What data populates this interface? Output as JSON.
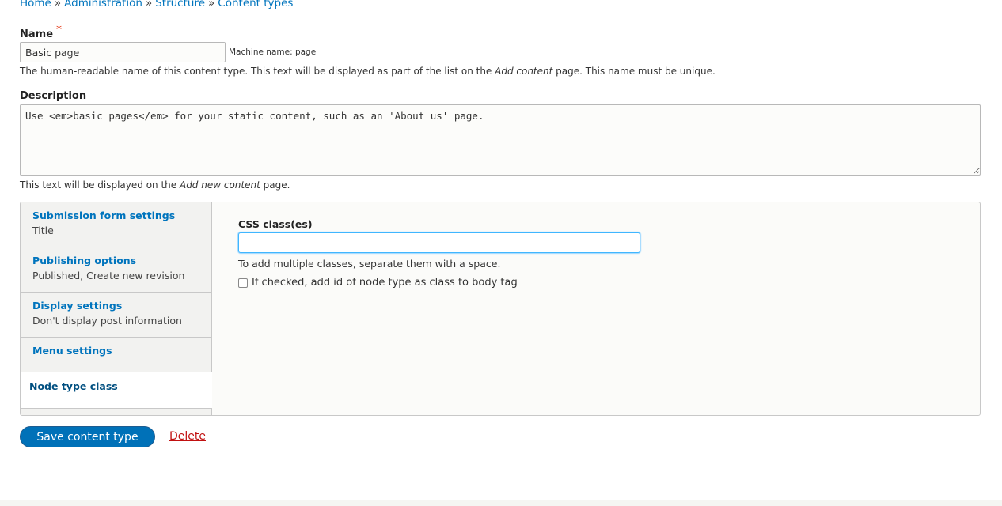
{
  "breadcrumb": {
    "items": [
      "Home",
      "Administration",
      "Structure",
      "Content types"
    ],
    "separator": "»"
  },
  "name_field": {
    "label": "Name",
    "required_marker": "*",
    "value": "Basic page",
    "machine_name": "Machine name: page",
    "help_pre": "The human-readable name of this content type. This text will be displayed as part of the list on the ",
    "help_em": "Add content",
    "help_post": " page. This name must be unique."
  },
  "description_field": {
    "label": "Description",
    "value": "Use <em>basic pages</em> for your static content, such as an 'About us' page.",
    "help_pre": "This text will be displayed on the ",
    "help_em": "Add new content",
    "help_post": " page."
  },
  "vertical_tabs": [
    {
      "title": "Submission form settings",
      "summary": "Title"
    },
    {
      "title": "Publishing options",
      "summary": "Published, Create new revision"
    },
    {
      "title": "Display settings",
      "summary": "Don't display post information"
    },
    {
      "title": "Menu settings",
      "summary": ""
    },
    {
      "title": "Node type class",
      "summary": "",
      "selected": true
    }
  ],
  "pane": {
    "css_label": "CSS class(es)",
    "css_value": "",
    "css_hint": "To add multiple classes, separate them with a space.",
    "checkbox_label": "If checked, add id of node type as class to body tag",
    "checkbox_checked": false
  },
  "actions": {
    "save_label": "Save content type",
    "delete_label": "Delete"
  },
  "colors": {
    "link": "#0074bd",
    "primary_button": "#0071b8",
    "danger_link": "#c11111",
    "required": "#e32700",
    "focus_border": "#40b6ff"
  }
}
